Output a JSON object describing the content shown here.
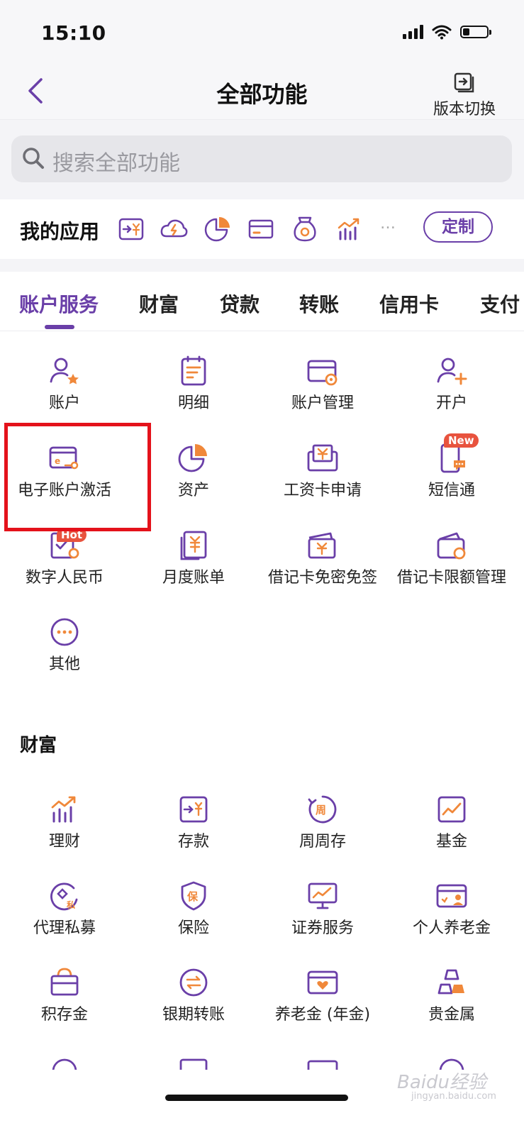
{
  "status_bar": {
    "time": "15:10"
  },
  "header": {
    "title": "全部功能",
    "version_label": "版本切换"
  },
  "search": {
    "placeholder": "搜索全部功能"
  },
  "my_apps": {
    "title": "我的应用",
    "more": "…",
    "customize_label": "定制",
    "icons": [
      "transfer-yuan-icon",
      "cloud-bolt-icon",
      "pie-chart-icon",
      "card-icon",
      "money-bag-icon",
      "bar-trend-icon"
    ]
  },
  "tabs": [
    "账户服务",
    "财富",
    "贷款",
    "转账",
    "信用卡",
    "支付"
  ],
  "active_tab": "账户服务",
  "account_services": {
    "items": [
      {
        "label": "账户",
        "icon": "user-star-icon"
      },
      {
        "label": "明细",
        "icon": "document-list-icon"
      },
      {
        "label": "账户管理",
        "icon": "card-gear-icon"
      },
      {
        "label": "开户",
        "icon": "user-plus-icon"
      },
      {
        "label": "电子账户激活",
        "icon": "ecard-key-icon"
      },
      {
        "label": "资产",
        "icon": "pie-chart-icon"
      },
      {
        "label": "工资卡申请",
        "icon": "salary-card-icon"
      },
      {
        "label": "短信通",
        "icon": "phone-message-icon",
        "badge": "New"
      },
      {
        "label": "数字人民币",
        "icon": "digital-rmb-icon",
        "badge": "Hot"
      },
      {
        "label": "月度账单",
        "icon": "monthly-bill-icon"
      },
      {
        "label": "借记卡免密免签",
        "icon": "debit-card-yuan-icon"
      },
      {
        "label": "借记卡限额管理",
        "icon": "wallet-gear-icon"
      },
      {
        "label": "其他",
        "icon": "more-circle-icon"
      }
    ]
  },
  "wealth": {
    "title": "财富",
    "items": [
      {
        "label": "理财",
        "icon": "bar-trend-icon"
      },
      {
        "label": "存款",
        "icon": "deposit-icon"
      },
      {
        "label": "周周存",
        "icon": "weekly-save-icon"
      },
      {
        "label": "基金",
        "icon": "fund-chart-icon"
      },
      {
        "label": "代理私募",
        "icon": "private-fund-icon"
      },
      {
        "label": "保险",
        "icon": "insurance-shield-icon"
      },
      {
        "label": "证券服务",
        "icon": "securities-monitor-icon"
      },
      {
        "label": "个人养老金",
        "icon": "pension-card-icon"
      },
      {
        "label": "积存金",
        "icon": "gold-bag-icon"
      },
      {
        "label": "银期转账",
        "icon": "exchange-circle-icon"
      },
      {
        "label": "养老金 (年金)",
        "icon": "annuity-card-icon"
      },
      {
        "label": "贵金属",
        "icon": "gold-bars-icon"
      }
    ]
  },
  "watermark": {
    "text": "Baidu经验",
    "sub": "jingyan.baidu.com"
  },
  "colors": {
    "brand_purple": "#6a3fa8",
    "accent_orange": "#f0883a",
    "badge_red": "#e8533e",
    "highlight_red": "#e4121b"
  }
}
